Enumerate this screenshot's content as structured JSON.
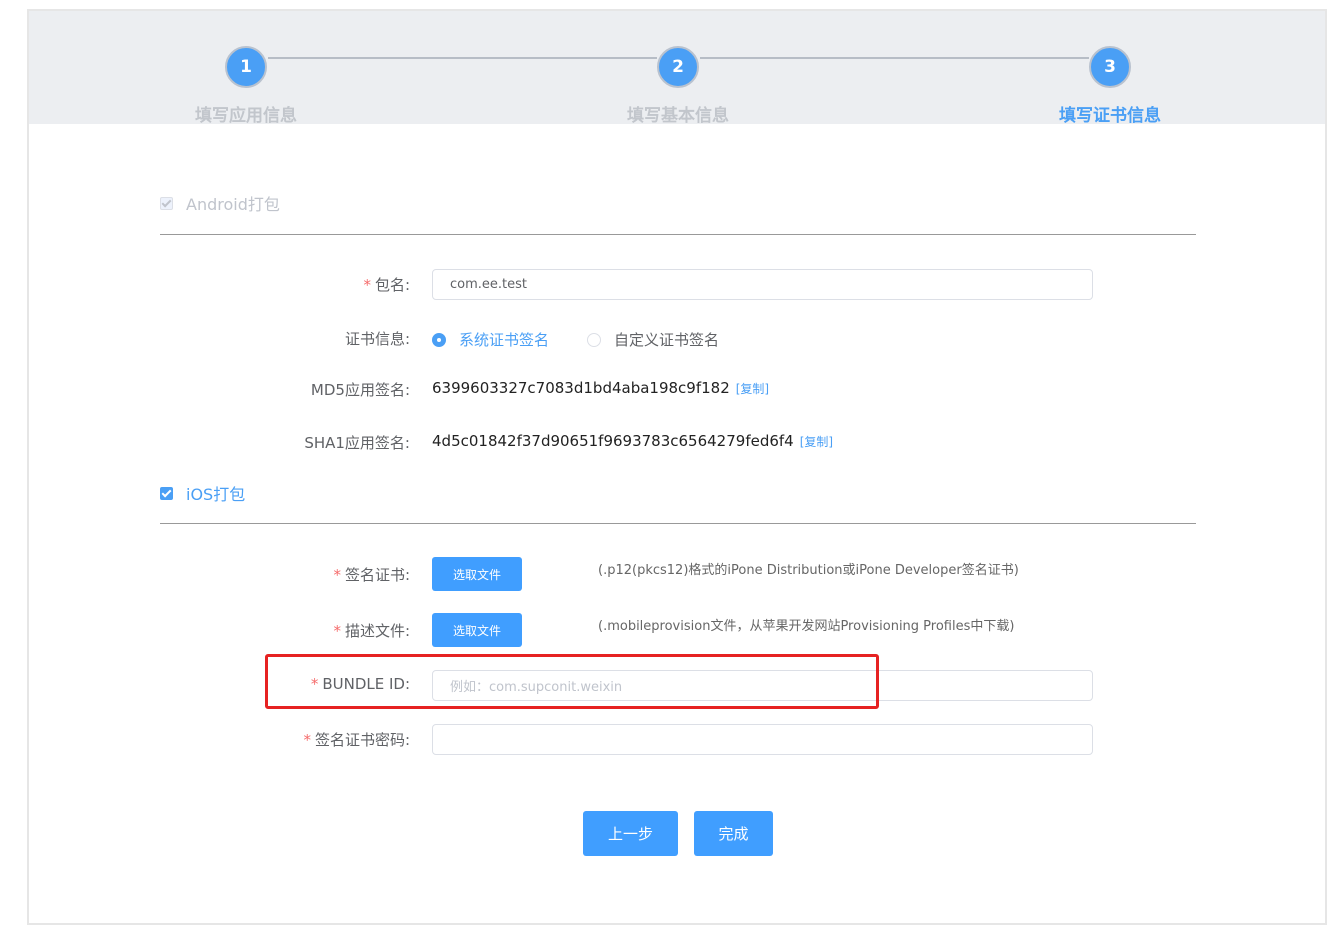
{
  "steps": [
    {
      "number": "1",
      "label": "填写应用信息"
    },
    {
      "number": "2",
      "label": "填写基本信息"
    },
    {
      "number": "3",
      "label": "填写证书信息"
    }
  ],
  "android": {
    "checkbox_label": "Android打包",
    "package_label": "包名:",
    "package_value": "com.ee.test",
    "cert_label": "证书信息:",
    "cert_options": [
      "系统证书签名",
      "自定义证书签名"
    ],
    "cert_selected": "系统证书签名",
    "md5_label": "MD5应用签名:",
    "md5_value": "6399603327c7083d1bd4aba198c9f182",
    "sha1_label": "SHA1应用签名:",
    "sha1_value": "4d5c01842f37d90651f9693783c6564279fed6f4",
    "copy_link": "[复制]"
  },
  "ios": {
    "checkbox_label": "iOS打包",
    "sign_cert_label": "签名证书:",
    "profile_label": "描述文件:",
    "choose_file": "选取文件",
    "sign_cert_hint": "(.p12(pkcs12)格式的iPone Distribution或iPone Developer签名证书)",
    "profile_hint": "(.mobileprovision文件，从苹果开发网站Provisioning Profiles中下载)",
    "bundle_label": "BUNDLE ID:",
    "bundle_placeholder": "例如：com.supconit.weixin",
    "password_label": "签名证书密码:"
  },
  "buttons": {
    "prev": "上一步",
    "finish": "完成"
  },
  "colors": {
    "accent": "#409eff",
    "required": "#f56c6c",
    "highlight": "#e62222"
  }
}
